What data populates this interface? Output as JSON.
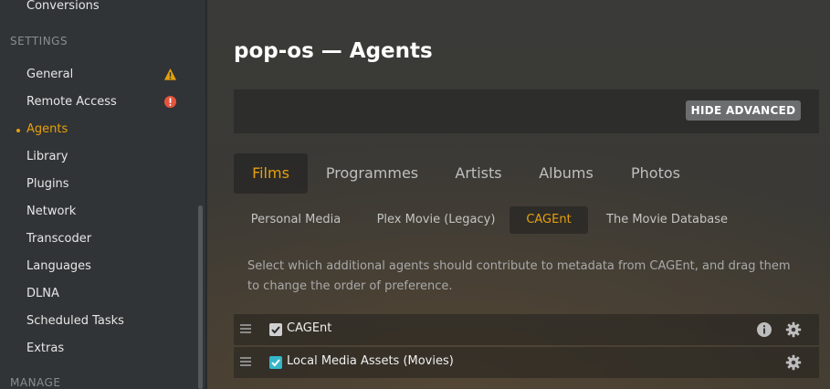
{
  "sidebar": {
    "items_top": [
      {
        "label": "Conversions"
      }
    ],
    "settings_heading": "SETTINGS",
    "settings_items": [
      {
        "label": "General",
        "badge": "warning"
      },
      {
        "label": "Remote Access",
        "badge": "error"
      },
      {
        "label": "Agents",
        "active": true
      },
      {
        "label": "Library"
      },
      {
        "label": "Plugins"
      },
      {
        "label": "Network"
      },
      {
        "label": "Transcoder"
      },
      {
        "label": "Languages"
      },
      {
        "label": "DLNA"
      },
      {
        "label": "Scheduled Tasks"
      },
      {
        "label": "Extras"
      }
    ],
    "manage_heading": "MANAGE"
  },
  "main": {
    "title": "pop-os — Agents",
    "hide_advanced_label": "HIDE ADVANCED",
    "tabs": [
      {
        "label": "Films",
        "active": true
      },
      {
        "label": "Programmes"
      },
      {
        "label": "Artists"
      },
      {
        "label": "Albums"
      },
      {
        "label": "Photos"
      }
    ],
    "subtabs": [
      {
        "label": "Personal Media"
      },
      {
        "label": "Plex Movie (Legacy)"
      },
      {
        "label": "CAGEnt",
        "active": true
      },
      {
        "label": "The Movie Database"
      }
    ],
    "description": "Select which additional agents should contribute to metadata from CAGEnt, and drag them to change the order of preference.",
    "agents": [
      {
        "label": "CAGEnt",
        "checked": true,
        "has_info": true,
        "has_settings": true
      },
      {
        "label": "Local Media Assets (Movies)",
        "checked": true,
        "has_info": false,
        "has_settings": true
      }
    ]
  },
  "colors": {
    "accent": "#e5a00d",
    "warning": "#e5a00d",
    "error": "#e5533d",
    "checkbox_teal": "#35b7c9"
  },
  "icons": [
    "warning-icon",
    "error-icon",
    "drag-handle-icon",
    "checkbox-check-icon",
    "info-icon",
    "gear-icon"
  ]
}
